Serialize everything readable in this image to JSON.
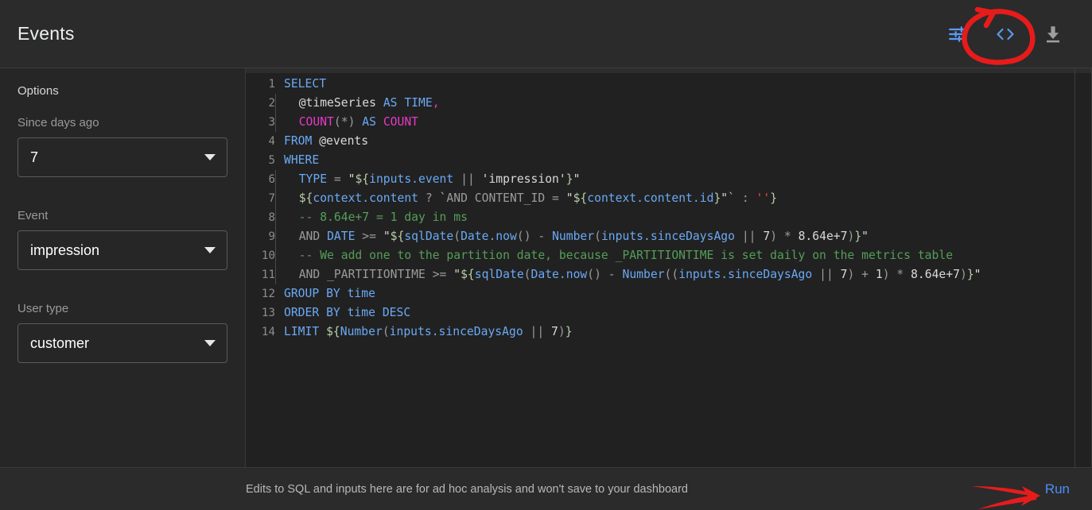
{
  "header": {
    "title": "Events",
    "actions": [
      {
        "name": "tune-icon",
        "label": "Options / tune"
      },
      {
        "name": "code-icon",
        "label": "Code editor"
      },
      {
        "name": "download-icon",
        "label": "Download"
      }
    ]
  },
  "sidebar": {
    "heading": "Options",
    "fields": [
      {
        "label": "Since days ago",
        "value": "7"
      },
      {
        "label": "Event",
        "value": "impression"
      },
      {
        "label": "User type",
        "value": "customer"
      }
    ]
  },
  "editor": {
    "language": "sql",
    "lines": [
      {
        "n": "1",
        "text": "SELECT"
      },
      {
        "n": "2",
        "text": "  @timeSeries AS TIME,"
      },
      {
        "n": "3",
        "text": "  COUNT(*) AS COUNT"
      },
      {
        "n": "4",
        "text": "FROM @events"
      },
      {
        "n": "5",
        "text": "WHERE"
      },
      {
        "n": "6",
        "text": "  TYPE = \"${inputs.event || 'impression'}\""
      },
      {
        "n": "7",
        "text": "  ${context.content ? `AND CONTENT_ID = \"${context.content.id}\"` : ''}"
      },
      {
        "n": "8",
        "text": "  -- 8.64e+7 = 1 day in ms"
      },
      {
        "n": "9",
        "text": "  AND DATE >= \"${sqlDate(Date.now() - Number(inputs.sinceDaysAgo || 7) * 8.64e+7)}\""
      },
      {
        "n": "10",
        "text": "  -- We add one to the partition date, because _PARTITIONTIME is set daily on the metrics table"
      },
      {
        "n": "11",
        "text": "  AND _PARTITIONTIME >= \"${sqlDate(Date.now() - Number((inputs.sinceDaysAgo || 7) + 1) * 8.64e+7)}\""
      },
      {
        "n": "12",
        "text": "GROUP BY time"
      },
      {
        "n": "13",
        "text": "ORDER BY time DESC"
      },
      {
        "n": "14",
        "text": "LIMIT ${Number(inputs.sinceDaysAgo || 7)}"
      }
    ]
  },
  "footer": {
    "note": "Edits to SQL and inputs here are for ad hoc analysis and won't save to your dashboard",
    "run_label": "Run"
  },
  "annotations": {
    "circle_target": "code-icon",
    "arrow_target": "run-button",
    "color": "#e81b1b"
  },
  "colors": {
    "accent_blue": "#4e8df5",
    "keyword_blue": "#6aa9f4",
    "function_magenta": "#e838c8",
    "comment_green": "#549e58",
    "template_green": "#b5cea8",
    "empty_string_red": "#e04a3f",
    "annotation_red": "#e81b1b",
    "background": "#212121",
    "panel": "#262626"
  }
}
